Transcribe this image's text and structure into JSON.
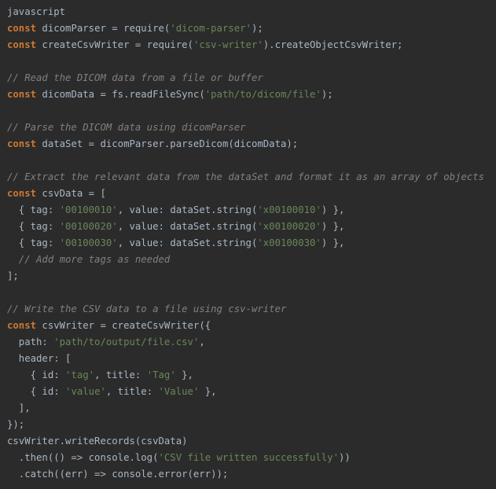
{
  "editor": {
    "theme": {
      "background": "#2b2b2b",
      "plain": "#a9b7c6",
      "keyword": "#cc7832",
      "string": "#6a8759",
      "comment": "#808080"
    },
    "lines": [
      [
        {
          "t": "javascript",
          "k": "lang"
        }
      ],
      [
        {
          "t": "const",
          "k": "keyword"
        },
        {
          "t": " dicomParser = require(",
          "k": "plain"
        },
        {
          "t": "'dicom-parser'",
          "k": "string"
        },
        {
          "t": ");",
          "k": "plain"
        }
      ],
      [
        {
          "t": "const",
          "k": "keyword"
        },
        {
          "t": " createCsvWriter = require(",
          "k": "plain"
        },
        {
          "t": "'csv-writer'",
          "k": "string"
        },
        {
          "t": ").createObjectCsvWriter;",
          "k": "plain"
        }
      ],
      [],
      [
        {
          "t": "// Read the DICOM data from a file or buffer",
          "k": "comment"
        }
      ],
      [
        {
          "t": "const",
          "k": "keyword"
        },
        {
          "t": " dicomData = fs.readFileSync(",
          "k": "plain"
        },
        {
          "t": "'path/to/dicom/file'",
          "k": "string"
        },
        {
          "t": ");",
          "k": "plain"
        }
      ],
      [],
      [
        {
          "t": "// Parse the DICOM data using dicomParser",
          "k": "comment"
        }
      ],
      [
        {
          "t": "const",
          "k": "keyword"
        },
        {
          "t": " dataSet = dicomParser.parseDicom(dicomData);",
          "k": "plain"
        }
      ],
      [],
      [
        {
          "t": "// Extract the relevant data from the dataSet and format it as an array of objects",
          "k": "comment"
        }
      ],
      [
        {
          "t": "const",
          "k": "keyword"
        },
        {
          "t": " csvData = [",
          "k": "plain"
        }
      ],
      [
        {
          "t": "  { tag: ",
          "k": "plain"
        },
        {
          "t": "'00100010'",
          "k": "string"
        },
        {
          "t": ", value: dataSet.string(",
          "k": "plain"
        },
        {
          "t": "'x00100010'",
          "k": "string"
        },
        {
          "t": ") },",
          "k": "plain"
        }
      ],
      [
        {
          "t": "  { tag: ",
          "k": "plain"
        },
        {
          "t": "'00100020'",
          "k": "string"
        },
        {
          "t": ", value: dataSet.string(",
          "k": "plain"
        },
        {
          "t": "'x00100020'",
          "k": "string"
        },
        {
          "t": ") },",
          "k": "plain"
        }
      ],
      [
        {
          "t": "  { tag: ",
          "k": "plain"
        },
        {
          "t": "'00100030'",
          "k": "string"
        },
        {
          "t": ", value: dataSet.string(",
          "k": "plain"
        },
        {
          "t": "'x00100030'",
          "k": "string"
        },
        {
          "t": ") },",
          "k": "plain"
        }
      ],
      [
        {
          "t": "  // Add more tags as needed",
          "k": "comment"
        }
      ],
      [
        {
          "t": "];",
          "k": "plain"
        }
      ],
      [],
      [
        {
          "t": "// Write the CSV data to a file using csv-writer",
          "k": "comment"
        }
      ],
      [
        {
          "t": "const",
          "k": "keyword"
        },
        {
          "t": " csvWriter = createCsvWriter({",
          "k": "plain"
        }
      ],
      [
        {
          "t": "  path: ",
          "k": "plain"
        },
        {
          "t": "'path/to/output/file.csv'",
          "k": "string"
        },
        {
          "t": ",",
          "k": "plain"
        }
      ],
      [
        {
          "t": "  header: [",
          "k": "plain"
        }
      ],
      [
        {
          "t": "    { id: ",
          "k": "plain"
        },
        {
          "t": "'tag'",
          "k": "string"
        },
        {
          "t": ", title: ",
          "k": "plain"
        },
        {
          "t": "'Tag'",
          "k": "string"
        },
        {
          "t": " },",
          "k": "plain"
        }
      ],
      [
        {
          "t": "    { id: ",
          "k": "plain"
        },
        {
          "t": "'value'",
          "k": "string"
        },
        {
          "t": ", title: ",
          "k": "plain"
        },
        {
          "t": "'Value'",
          "k": "string"
        },
        {
          "t": " },",
          "k": "plain"
        }
      ],
      [
        {
          "t": "  ],",
          "k": "plain"
        }
      ],
      [
        {
          "t": "});",
          "k": "plain"
        }
      ],
      [
        {
          "t": "csvWriter.writeRecords(csvData)",
          "k": "plain"
        }
      ],
      [
        {
          "t": "  .then(() => console.log(",
          "k": "plain"
        },
        {
          "t": "'CSV file written successfully'",
          "k": "string"
        },
        {
          "t": "))",
          "k": "plain"
        }
      ],
      [
        {
          "t": "  .catch((err) => console.error(err));",
          "k": "plain"
        }
      ]
    ]
  }
}
